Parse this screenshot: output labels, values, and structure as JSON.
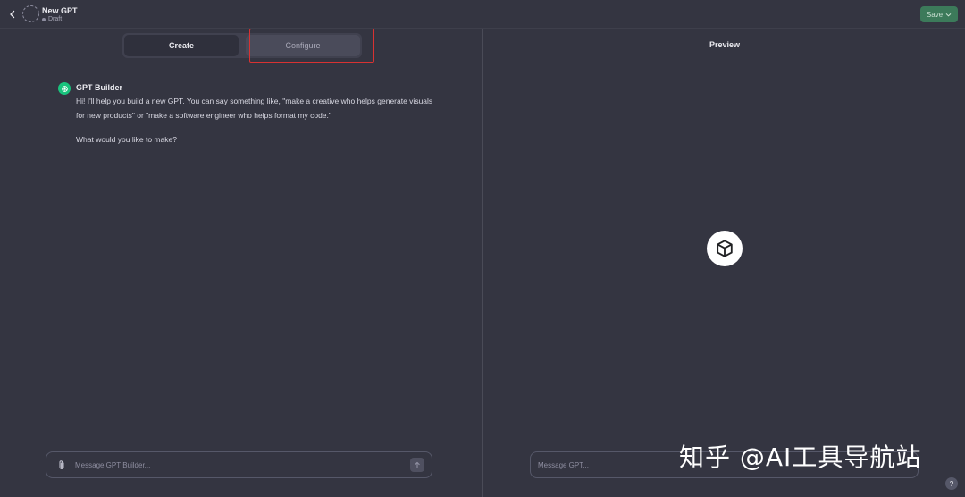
{
  "header": {
    "title": "New GPT",
    "status": "Draft",
    "save_label": "Save"
  },
  "builder": {
    "tabs": [
      {
        "label": "Create",
        "active": true
      },
      {
        "label": "Configure",
        "active": false
      }
    ],
    "message": {
      "author": "GPT Builder",
      "paragraphs": [
        "Hi! I'll help you build a new GPT. You can say something like, \"make a creative who helps generate visuals for new products\" or \"make a software engineer who helps format my code.\"",
        "What would you like to make?"
      ]
    },
    "composer": {
      "placeholder": "Message GPT Builder..."
    }
  },
  "preview": {
    "title": "Preview",
    "composer": {
      "placeholder": "Message GPT..."
    }
  },
  "watermark": "知乎 @AI工具导航站",
  "help_label": "?",
  "colors": {
    "background": "#343541",
    "accent_save": "#3c7a5a",
    "assistant_avatar": "#19c37d",
    "highlight": "#d83232"
  },
  "icons": {
    "back": "chevron-left-icon",
    "save_chevron": "chevron-down-icon",
    "attach": "paperclip-icon",
    "send": "arrow-up-icon",
    "preview_logo": "cube-icon",
    "assistant": "openai-logo-icon"
  }
}
